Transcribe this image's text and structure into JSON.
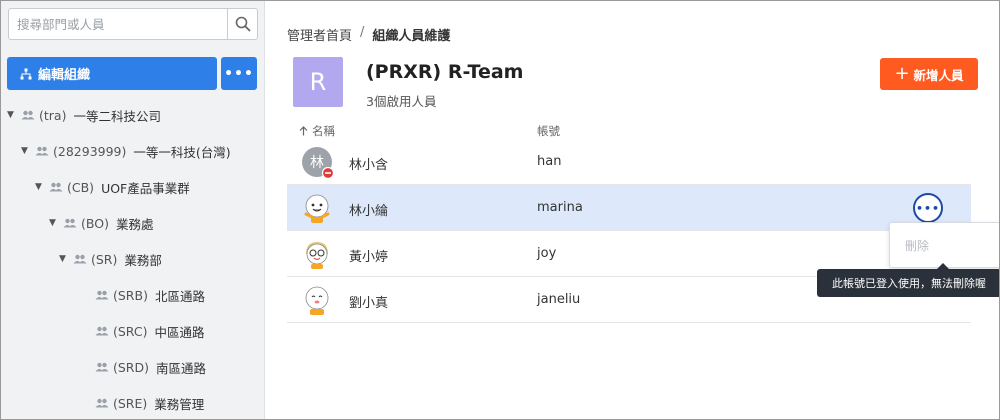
{
  "sidebar": {
    "search_placeholder": "搜尋部門或人員",
    "edit_button_label": "編輯組織",
    "more_button_label": "•••",
    "tree": [
      {
        "code": "(tra)",
        "name": "一等二科技公司",
        "expanded": true
      },
      {
        "code": "(28293999)",
        "name": "一等一科技(台灣)",
        "expanded": true
      },
      {
        "code": "(CB)",
        "name": "UOF產品事業群",
        "expanded": true
      },
      {
        "code": "(BO)",
        "name": "業務處",
        "expanded": true
      },
      {
        "code": "(SR)",
        "name": "業務部",
        "expanded": true
      },
      {
        "code": "(SRB)",
        "name": "北區通路",
        "expanded": false
      },
      {
        "code": "(SRC)",
        "name": "中區通路",
        "expanded": false
      },
      {
        "code": "(SRD)",
        "name": "南區通路",
        "expanded": false
      },
      {
        "code": "(SRE)",
        "name": "業務管理",
        "expanded": false
      }
    ]
  },
  "breadcrumb": {
    "home": "管理者首頁",
    "separator": "/",
    "current": "組織人員維護"
  },
  "team": {
    "avatar_letter": "R",
    "title": "(PRXR) R-Team",
    "subtitle": "3個啟用人員",
    "add_button_label": "新增人員",
    "add_button_icon": "plus-icon"
  },
  "table": {
    "col_name": "名稱",
    "col_account": "帳號",
    "sort_icon": "arrow-up-icon",
    "rows": [
      {
        "name": "林小含",
        "account": "han",
        "avatar_char": "林",
        "avatar_type": "letter",
        "disabled_badge": true
      },
      {
        "name": "林小綸",
        "account": "marina",
        "avatar_type": "cartoon",
        "selected": true
      },
      {
        "name": "黃小婷",
        "account": "joy",
        "avatar_type": "cartoon-glasses"
      },
      {
        "name": "劉小真",
        "account": "janeliu",
        "avatar_type": "cartoon"
      }
    ]
  },
  "row_menu": {
    "more_label": "•••",
    "delete_label": "刪除",
    "tooltip": "此帳號已登入使用，無法刪除喔"
  },
  "colors": {
    "primary_blue": "#2f7fe8",
    "accent_orange": "#ff5a1f",
    "team_avatar": "#b1a8f0",
    "selected_row": "#dde9fb"
  }
}
